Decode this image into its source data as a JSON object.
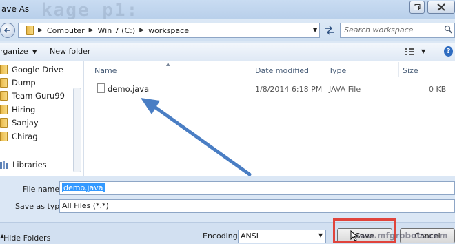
{
  "window": {
    "title": "ave As",
    "ghost_text": "kage p1:"
  },
  "address": {
    "crumbs": [
      "Computer",
      "Win 7 (C:)",
      "workspace"
    ],
    "search_placeholder": "Search workspace"
  },
  "toolbar": {
    "organize_label": "rganize",
    "new_folder_label": "New folder"
  },
  "nav": {
    "items": [
      "Google Drive",
      "Dump",
      "Team Guru99",
      "Hiring",
      "Sanjay",
      "Chirag"
    ],
    "libraries_label": "Libraries"
  },
  "columns": {
    "name": "Name",
    "date": "Date modified",
    "type": "Type",
    "size": "Size"
  },
  "files": [
    {
      "name": "demo.java",
      "date": "1/8/2014 6:18 PM",
      "type": "JAVA File",
      "size": "0 KB"
    }
  ],
  "form": {
    "file_name_label": "File name:",
    "file_name_value": "demo.java",
    "save_as_type_label": "Save as type:",
    "save_as_type_value": "All Files  (*.*)"
  },
  "footer": {
    "hide_folders_label": "Hide Folders",
    "encoding_label": "Encoding:",
    "encoding_value": "ANSI",
    "save_label": "Save",
    "cancel_label": "Cancel",
    "watermark": "www.mfgrobots.com"
  },
  "colors": {
    "highlight_box": "#e0443c",
    "arrow": "#4a7ec4",
    "selection": "#3399ff"
  }
}
